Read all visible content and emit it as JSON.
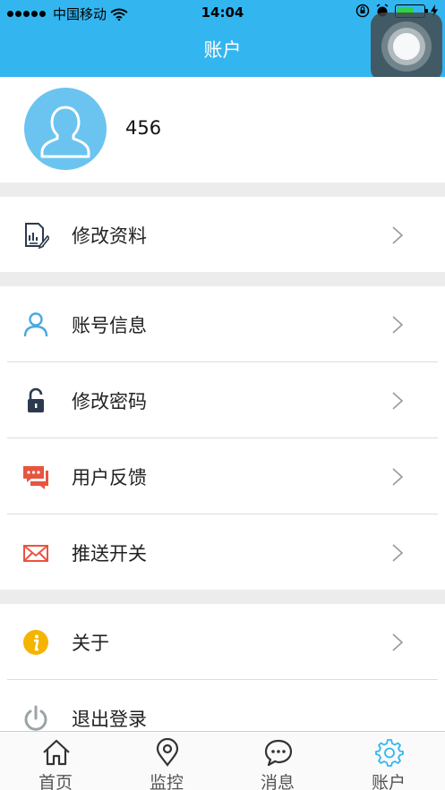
{
  "status_bar": {
    "carrier": "中国移动",
    "time": "14:04"
  },
  "nav": {
    "title": "账户"
  },
  "profile": {
    "username": "456"
  },
  "groups": [
    [
      {
        "label": "修改资料",
        "icon": "edit-document-icon"
      }
    ],
    [
      {
        "label": "账号信息",
        "icon": "user-icon"
      },
      {
        "label": "修改密码",
        "icon": "lock-icon"
      },
      {
        "label": "用户反馈",
        "icon": "chat-feedback-icon"
      },
      {
        "label": "推送开关",
        "icon": "envelope-icon"
      }
    ],
    [
      {
        "label": "关于",
        "icon": "info-icon"
      },
      {
        "label": "退出登录",
        "icon": "power-icon"
      }
    ]
  ],
  "tabs": [
    {
      "label": "首页",
      "icon": "home-icon"
    },
    {
      "label": "监控",
      "icon": "location-pin-icon"
    },
    {
      "label": "消息",
      "icon": "message-icon"
    },
    {
      "label": "账户",
      "icon": "gear-icon",
      "active": true
    }
  ],
  "colors": {
    "accent": "#33b6f0",
    "active_tab": "#33b6f0",
    "feedback": "#e8553f",
    "info": "#f5b400"
  }
}
